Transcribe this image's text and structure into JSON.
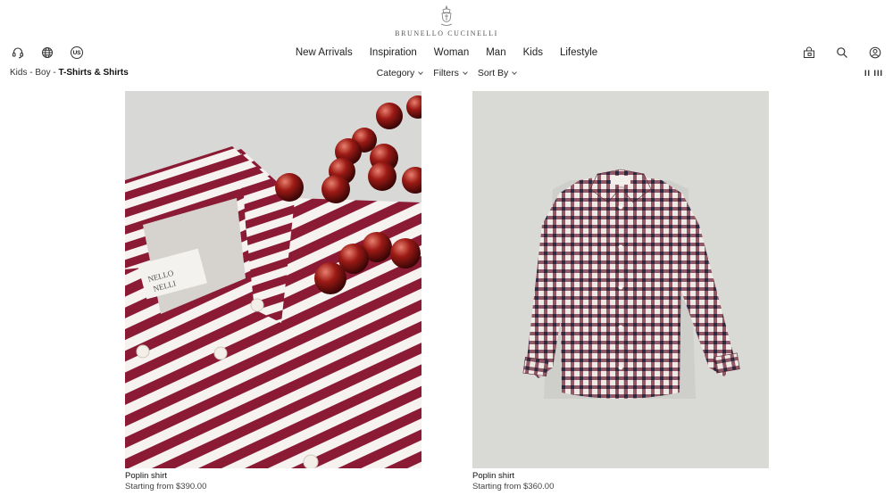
{
  "brand": {
    "name": "BRUNELLO CUCINELLI",
    "logo_icon": "crest-emblem-icon"
  },
  "utility_left": [
    {
      "name": "customer-service-icon"
    },
    {
      "name": "globe-icon"
    },
    {
      "name": "country-badge",
      "label": "US"
    }
  ],
  "utility_right": [
    {
      "name": "shopping-bag-icon"
    },
    {
      "name": "search-icon"
    },
    {
      "name": "account-icon"
    }
  ],
  "nav": {
    "items": [
      "New Arrivals",
      "Inspiration",
      "Woman",
      "Man",
      "Kids",
      "Lifestyle"
    ]
  },
  "breadcrumb": {
    "items": [
      "Kids",
      "Boy"
    ],
    "separator": " - ",
    "current": "T-Shirts & Shirts"
  },
  "filters": {
    "category_label": "Category",
    "filters_label": "Filters",
    "sort_label": "Sort By"
  },
  "view_toggle": "II III",
  "products": [
    {
      "name": "Poplin shirt",
      "price": "Starting from $390.00",
      "image_desc": "red-and-white-striped-shirt-with-glass-beads",
      "accent": "#8b1a35"
    },
    {
      "name": "Poplin shirt",
      "price": "Starting from $360.00",
      "image_desc": "burgundy-navy-checked-shirt",
      "accent": "#6e2838"
    }
  ],
  "colors": {
    "background": "#ffffff",
    "image_backdrop": "#d9d9d6",
    "text": "#222222"
  }
}
